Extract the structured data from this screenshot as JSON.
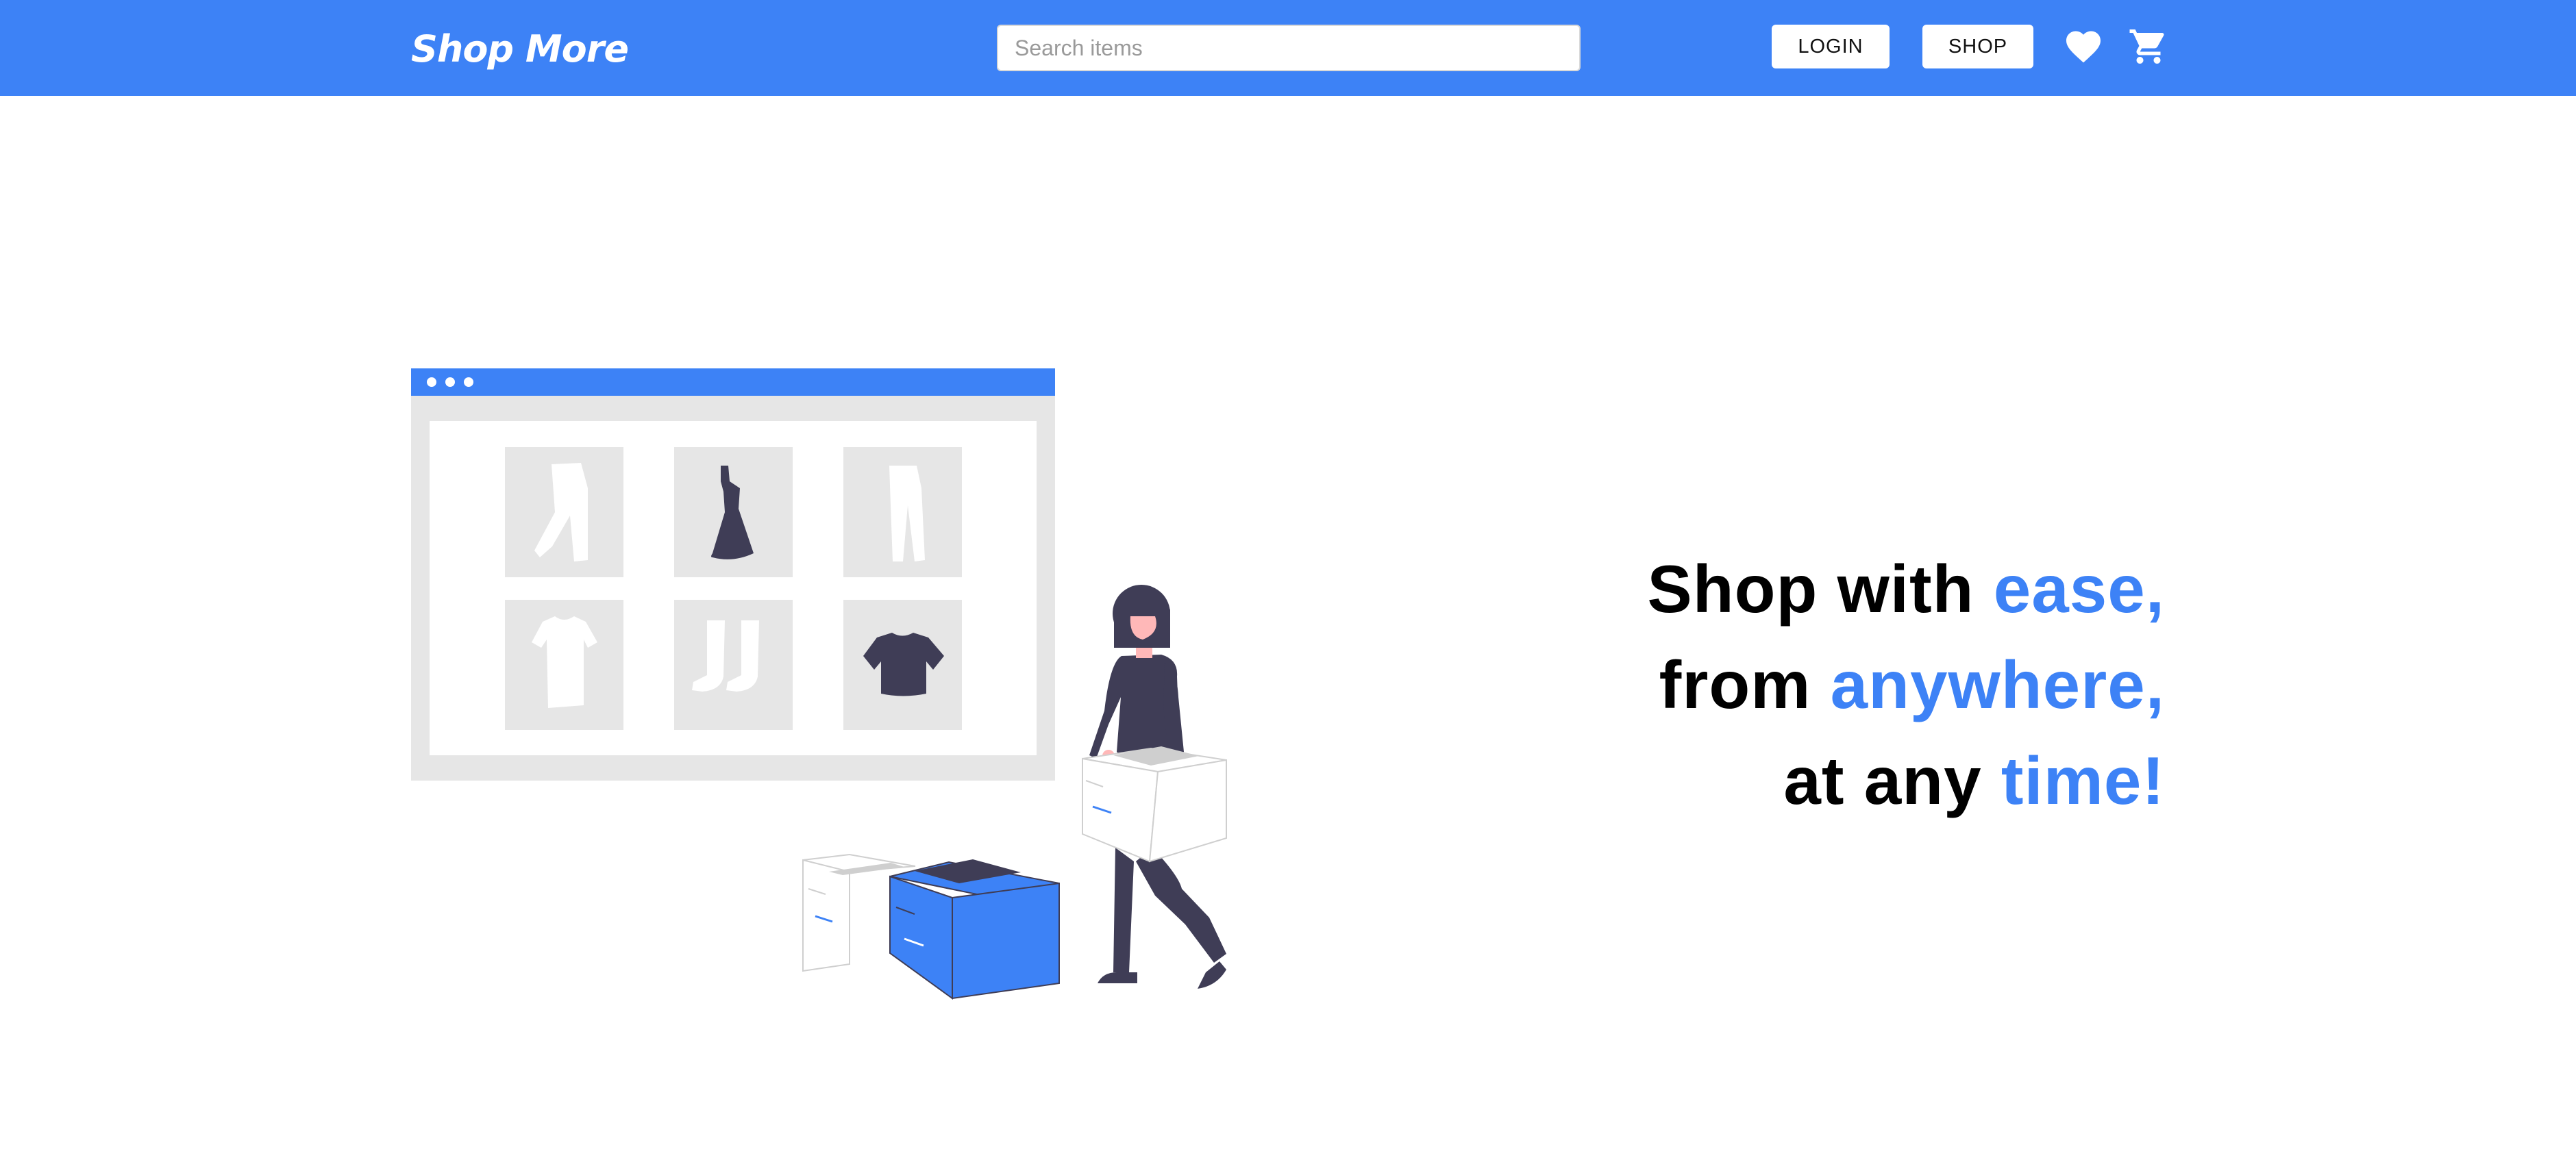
{
  "header": {
    "brand": "Shop More",
    "search_placeholder": "Search items",
    "search_value": "",
    "login_label": "LOGIN",
    "shop_label": "SHOP",
    "wishlist_icon": "heart-icon",
    "cart_icon": "shopping-cart-icon"
  },
  "hero": {
    "line1_text": "Shop with ",
    "line1_accent": "ease,",
    "line2_text": "from ",
    "line2_accent": "anywhere,",
    "line3_text": "at any ",
    "line3_accent": "time!"
  },
  "colors": {
    "primary": "#3d82f6",
    "dark_figure": "#3f3d56",
    "light_gray": "#e6e6e6",
    "skin": "#ffb8b8"
  }
}
